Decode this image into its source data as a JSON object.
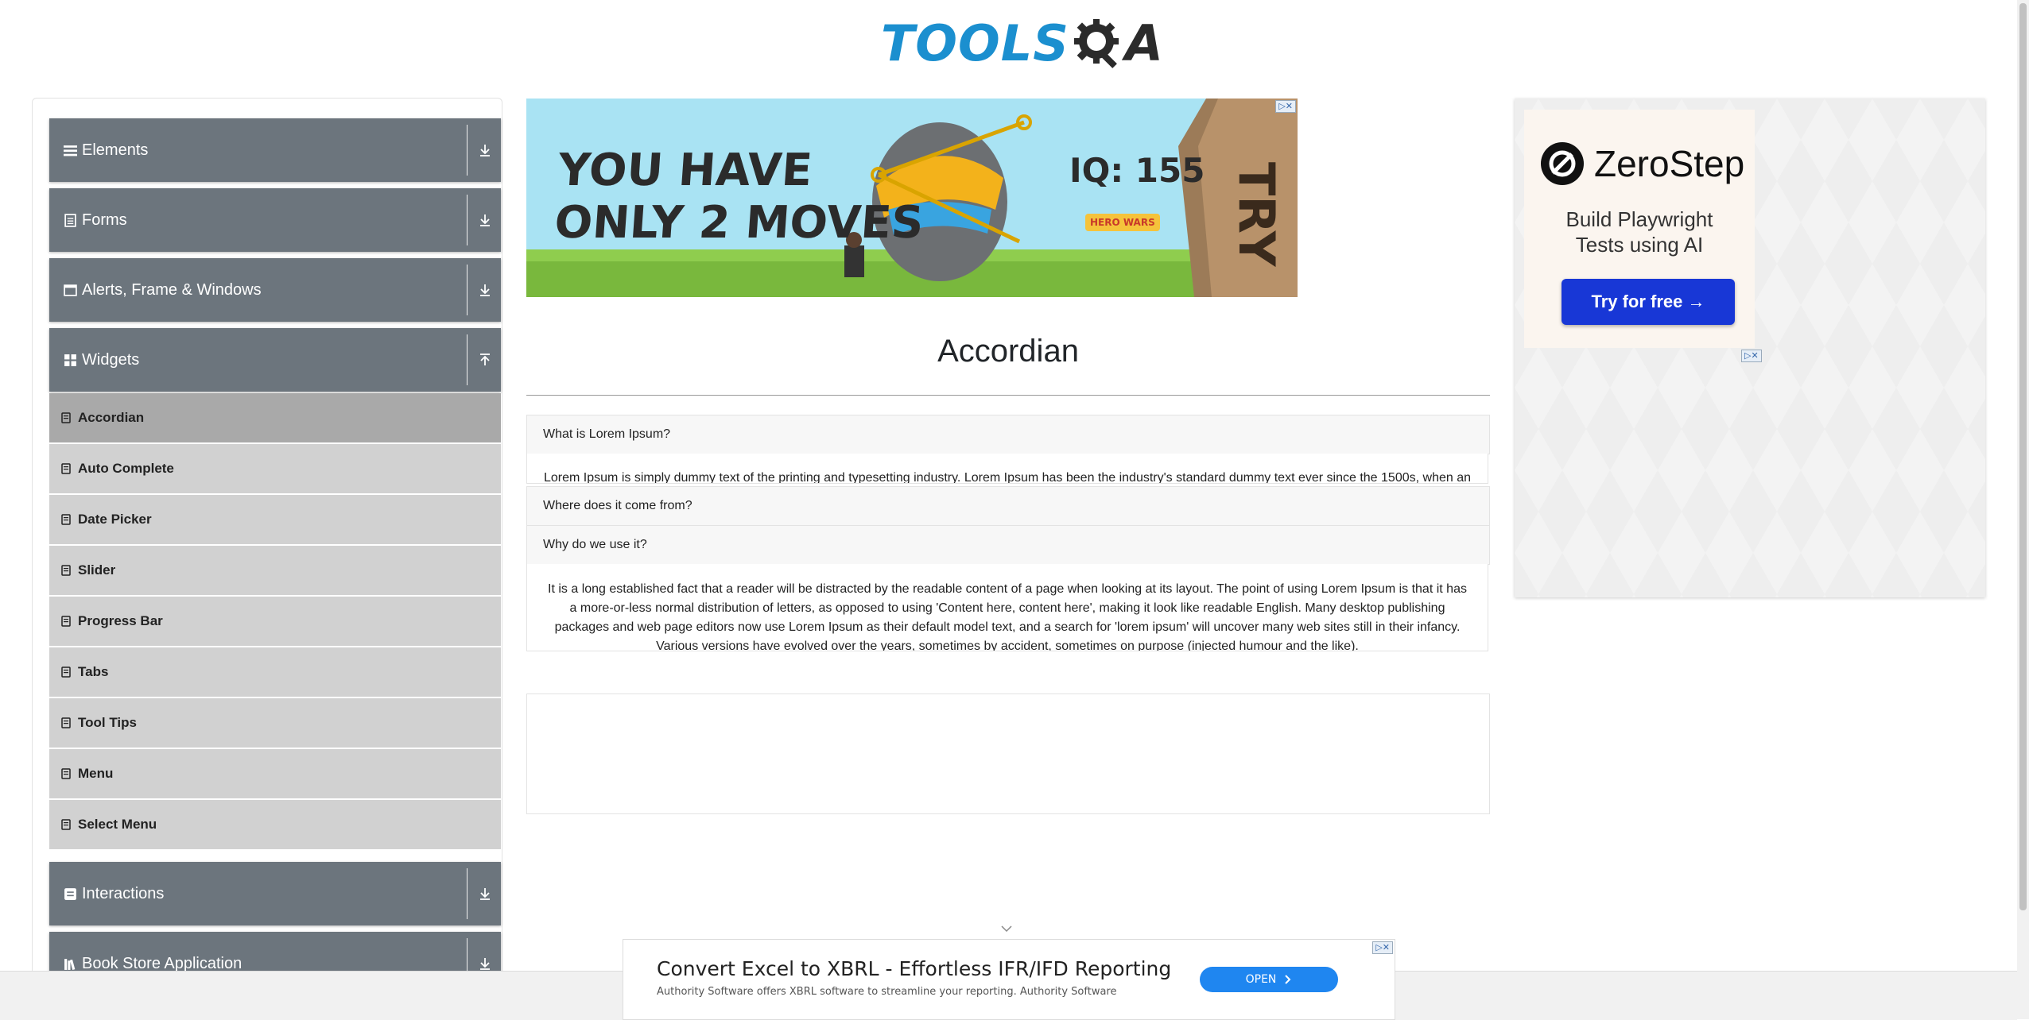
{
  "logo": {
    "text_left": "TOOLS",
    "text_right": "A"
  },
  "sidebar": {
    "groups": [
      {
        "label": "Elements",
        "icon": "list-icon"
      },
      {
        "label": "Forms",
        "icon": "document-icon"
      },
      {
        "label": "Alerts, Frame & Windows",
        "icon": "window-icon"
      },
      {
        "label": "Widgets",
        "icon": "grid-icon"
      },
      {
        "label": "Interactions",
        "icon": "interaction-icon"
      },
      {
        "label": "Book Store Application",
        "icon": "book-icon"
      }
    ],
    "widgets_items": [
      {
        "label": "Accordian",
        "active": true
      },
      {
        "label": "Auto Complete"
      },
      {
        "label": "Date Picker"
      },
      {
        "label": "Slider"
      },
      {
        "label": "Progress Bar"
      },
      {
        "label": "Tabs"
      },
      {
        "label": "Tool Tips"
      },
      {
        "label": "Menu"
      },
      {
        "label": "Select Menu"
      }
    ]
  },
  "banner_ad": {
    "headline_line1": "YOU HAVE",
    "headline_line2": "ONLY 2 MOVES",
    "iq": "IQ: 155",
    "brand": "HERO WARS",
    "cta": "TRY"
  },
  "main": {
    "title": "Accordian",
    "sections": [
      {
        "heading": "What is Lorem Ipsum?",
        "body": "Lorem Ipsum is simply dummy text of the printing and typesetting industry. Lorem Ipsum has been the industry's standard dummy text ever since the 1500s, when an"
      },
      {
        "heading": "Where does it come from?",
        "body": ""
      },
      {
        "heading": "Why do we use it?",
        "body": "It is a long established fact that a reader will be distracted by the readable content of a page when looking at its layout. The point of using Lorem Ipsum is that it has a more-or-less normal distribution of letters, as opposed to using 'Content here, content here', making it look like readable English. Many desktop publishing packages and web page editors now use Lorem Ipsum as their default model text, and a search for 'lorem ipsum' will uncover many web sites still in their infancy. Various versions have evolved over the years, sometimes by accident, sometimes on purpose (injected humour and the like)."
      }
    ]
  },
  "right_ad": {
    "brand": "ZeroStep",
    "subtitle_line1": "Build Playwright",
    "subtitle_line2": "Tests using AI",
    "cta": "Try for free →"
  },
  "bottom_ad": {
    "title": "Convert Excel to XBRL - Effortless IFR/IFD Reporting",
    "subtitle": "Authority Software offers XBRL software to streamline your reporting. Authority Software",
    "cta": "OPEN"
  },
  "ad_close": "▷✕",
  "colors": {
    "sidebar_header": "#6c757d",
    "menu_item": "#d1d1d1",
    "menu_active": "#a9a9a9",
    "brand_blue": "#1b8fcf"
  }
}
